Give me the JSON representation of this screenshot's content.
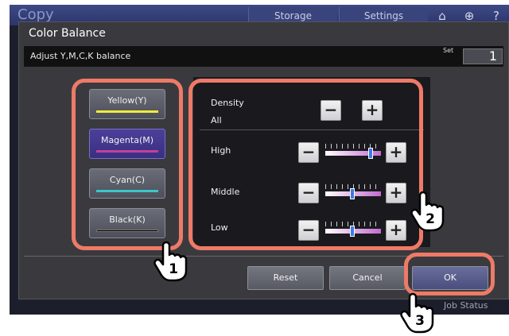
{
  "topbar": {
    "app_title": "Copy",
    "storage_label": "Storage",
    "settings_label": "Settings"
  },
  "dialog": {
    "title": "Color Balance",
    "instruction": "Adjust Y,M,C,K balance",
    "set_label": "Set",
    "set_value": "1"
  },
  "colors": [
    {
      "label": "Yellow(Y)",
      "color": "#f0ec3c",
      "selected": false
    },
    {
      "label": "Magenta(M)",
      "color": "#c0419a",
      "selected": true
    },
    {
      "label": "Cyan(C)",
      "color": "#3cc6c8",
      "selected": false
    },
    {
      "label": "Black(K)",
      "color": "#000000",
      "selected": false
    }
  ],
  "density": {
    "label": "Density",
    "sub": "All",
    "minus": "−",
    "plus": "+"
  },
  "levels": [
    {
      "label": "High",
      "value": 3,
      "min": -4,
      "max": 4
    },
    {
      "label": "Middle",
      "value": 0,
      "min": -4,
      "max": 4
    },
    {
      "label": "Low",
      "value": 0,
      "min": -4,
      "max": 4
    }
  ],
  "buttons": {
    "reset": "Reset",
    "cancel": "Cancel",
    "ok": "OK"
  },
  "footer": {
    "job_status": "Job Status"
  },
  "callouts": [
    "1",
    "2",
    "3"
  ],
  "theme": {
    "highlight": "#ee7a68",
    "selected": "#4c3f9a",
    "thumb": "#3a7be0"
  }
}
